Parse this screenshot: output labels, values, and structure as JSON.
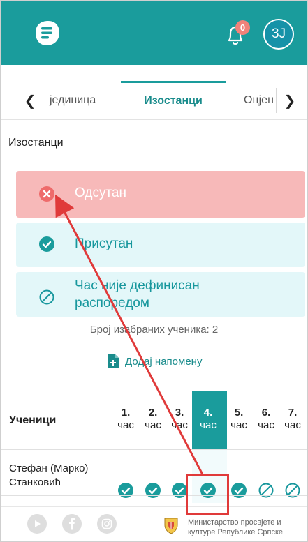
{
  "header": {
    "notification_count": "0",
    "user_initials": "3J",
    "logo_icon": "menu-list-logo",
    "bell_icon": "bell-icon",
    "colors": {
      "primary": "#1a9c9c",
      "badge": "#f0827a"
    }
  },
  "tabs": {
    "prev_icon": "chevron-left-icon",
    "next_icon": "chevron-right-icon",
    "items": [
      {
        "label": "јединица"
      },
      {
        "label": "Изостанци",
        "active": true
      },
      {
        "label": "Оцјен"
      }
    ]
  },
  "section": {
    "title": "Изостанци"
  },
  "options": [
    {
      "label": "Одсутан",
      "icon": "x-circle-icon",
      "color": "#f7b9b9"
    },
    {
      "label": "Присутан",
      "icon": "check-circle-icon",
      "color": "#e3f7f9"
    },
    {
      "label_line1": "Час није дефинисан",
      "label_line2": "распоредом",
      "icon": "ban-icon",
      "color": "#e3f7f9"
    }
  ],
  "selected_count_text": "Број изабраних ученика: 2",
  "add_note_label": "Додај напомену",
  "grid": {
    "students_header": "Ученици",
    "periods": [
      {
        "num": "1.",
        "sub": "час"
      },
      {
        "num": "2.",
        "sub": "час"
      },
      {
        "num": "3.",
        "sub": "час"
      },
      {
        "num": "4.",
        "sub": "час",
        "active": true
      },
      {
        "num": "5.",
        "sub": "час"
      },
      {
        "num": "6.",
        "sub": "час"
      },
      {
        "num": "7.",
        "sub": "час"
      }
    ],
    "rows": [
      {
        "name_line1": "Стефан (Марко)",
        "name_line2": "Станковић",
        "status": [
          "present",
          "present",
          "present",
          "present",
          "present",
          "undefined",
          "undefined"
        ]
      }
    ]
  },
  "footer": {
    "social_icons": [
      "youtube-icon",
      "facebook-icon",
      "instagram-icon"
    ],
    "ministry_line1": "Министарство просвјете и",
    "ministry_line2": "културе Републике Српске"
  }
}
